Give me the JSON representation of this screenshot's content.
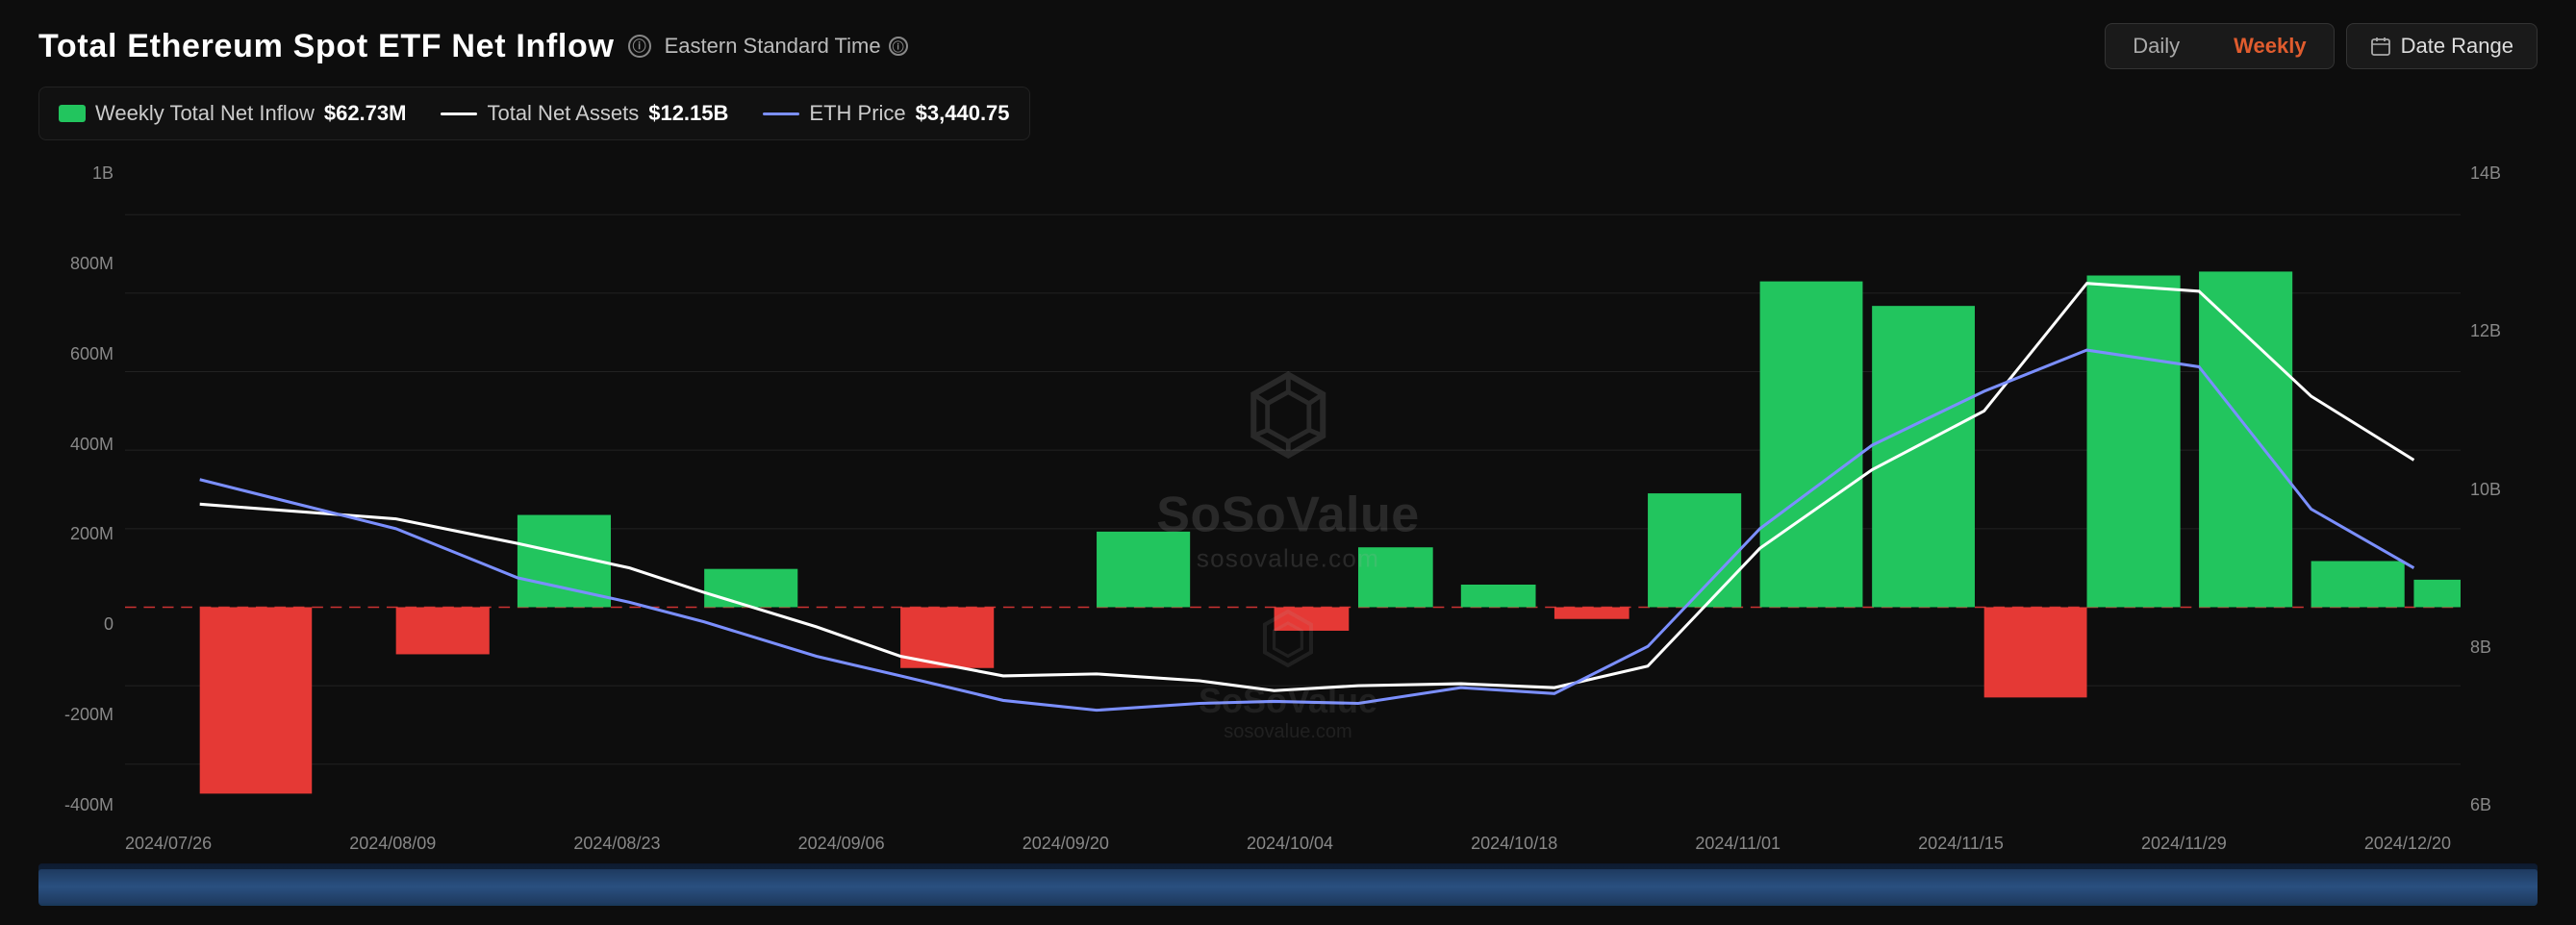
{
  "header": {
    "title": "Total Ethereum Spot ETF Net Inflow",
    "timezone": "Eastern Standard Time",
    "controls": {
      "daily_label": "Daily",
      "weekly_label": "Weekly",
      "date_range_label": "Date Range"
    }
  },
  "legend": {
    "items": [
      {
        "id": "weekly-net-inflow",
        "type": "green-bar",
        "label": "Weekly Total Net Inflow",
        "value": "$62.73M"
      },
      {
        "id": "total-net-assets",
        "type": "white-line",
        "label": "Total Net Assets",
        "value": "$12.15B"
      },
      {
        "id": "eth-price",
        "type": "blue-line",
        "label": "ETH Price",
        "value": "$3,440.75"
      }
    ]
  },
  "chart": {
    "y_axis_left": [
      "1B",
      "800M",
      "600M",
      "400M",
      "200M",
      "0",
      "-200M",
      "-400M"
    ],
    "y_axis_right": [
      "14B",
      "12B",
      "10B",
      "8B",
      "6B"
    ],
    "x_axis": [
      "2024/07/26",
      "2024/08/09",
      "2024/08/23",
      "2024/09/06",
      "2024/09/20",
      "2024/10/04",
      "2024/10/18",
      "2024/11/01",
      "2024/11/15",
      "2024/11/29",
      "2024/12/20"
    ],
    "watermark": {
      "brand": "SoSoValue",
      "url": "sosovalue.com"
    }
  }
}
